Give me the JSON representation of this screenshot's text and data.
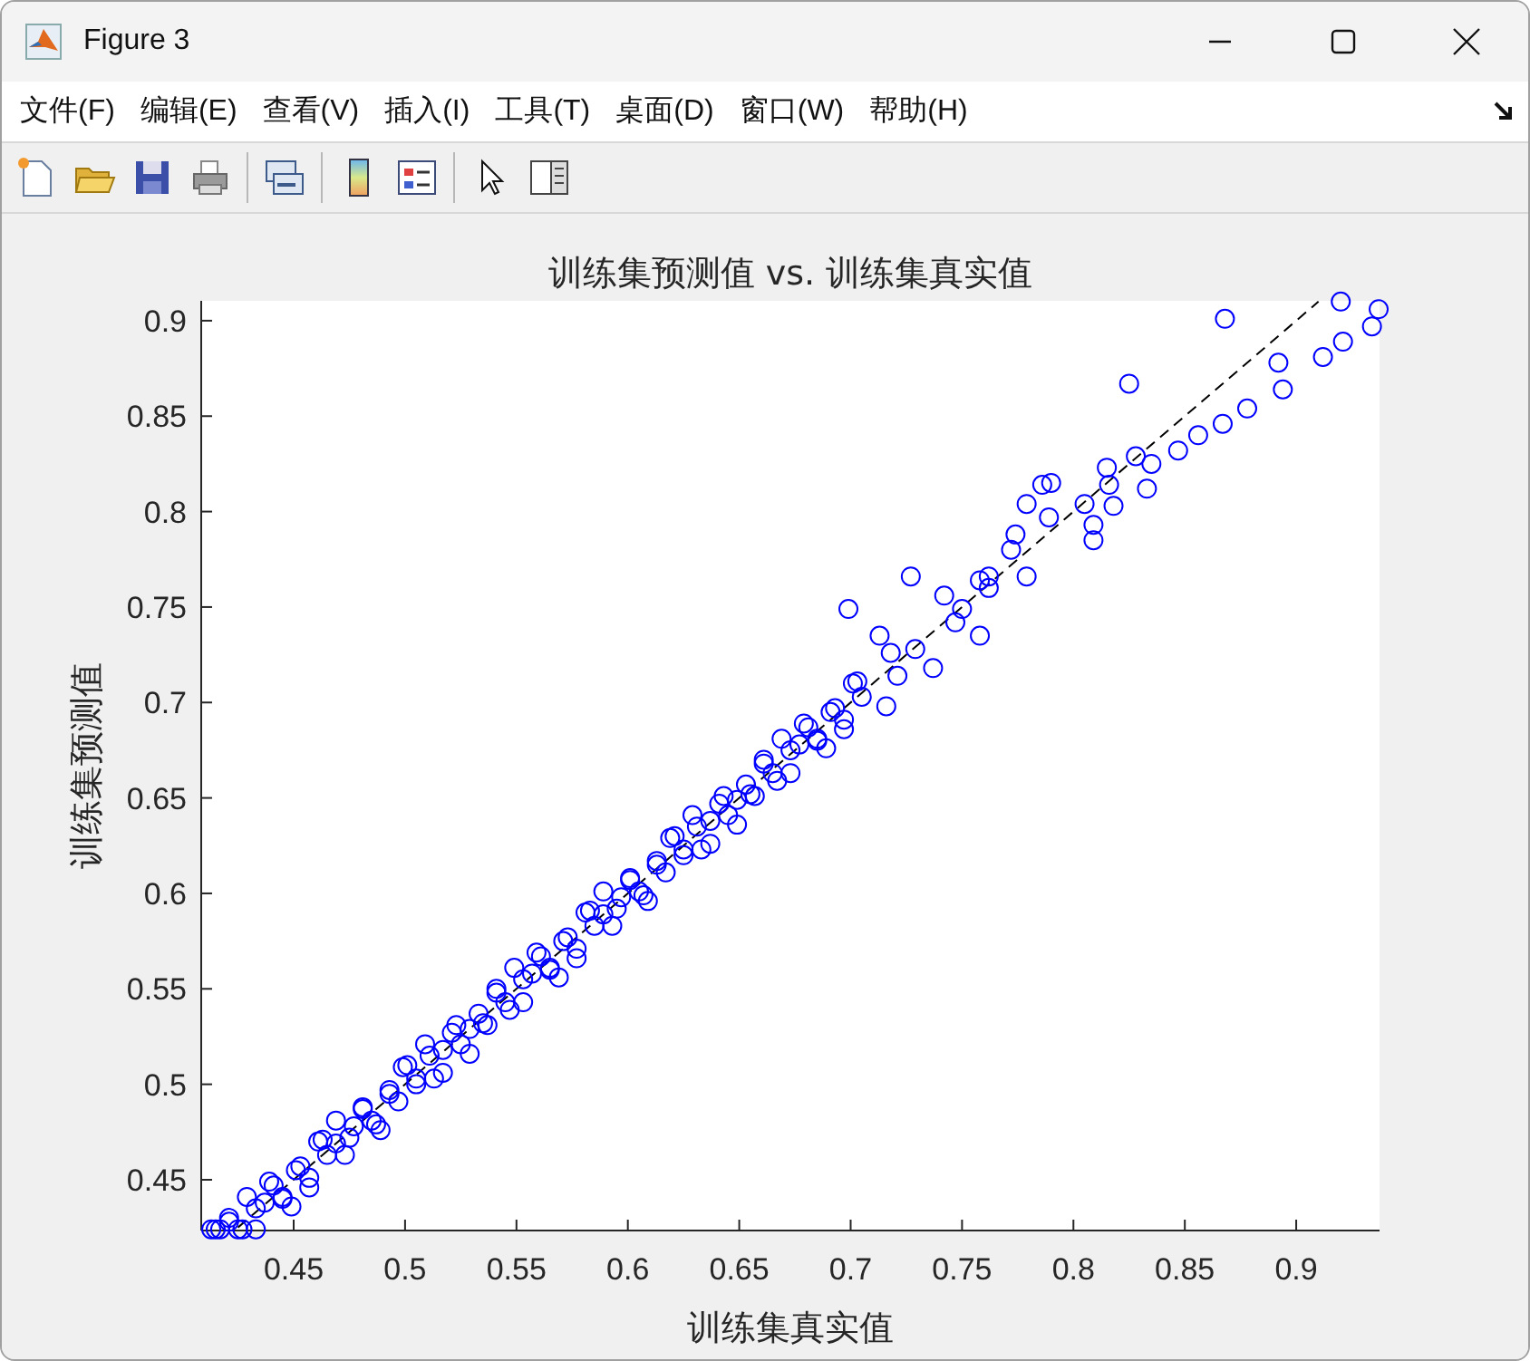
{
  "window": {
    "title": "Figure 3"
  },
  "menu": [
    "文件(F)",
    "编辑(E)",
    "查看(V)",
    "插入(I)",
    "工具(T)",
    "桌面(D)",
    "窗口(W)",
    "帮助(H)"
  ],
  "figure": {
    "chart_data": {
      "type": "scatter",
      "title": "训练集预测值 vs. 训练集真实值",
      "xlabel": "训练集真实值",
      "ylabel": "训练集预测值",
      "x": [
        0.413,
        0.417,
        0.421,
        0.425,
        0.429,
        0.433,
        0.437,
        0.441,
        0.445,
        0.449,
        0.453,
        0.457,
        0.461,
        0.465,
        0.469,
        0.473,
        0.477,
        0.481,
        0.485,
        0.489,
        0.493,
        0.497,
        0.501,
        0.505,
        0.509,
        0.513,
        0.517,
        0.521,
        0.525,
        0.529,
        0.533,
        0.537,
        0.541,
        0.545,
        0.549,
        0.553,
        0.557,
        0.561,
        0.565,
        0.569,
        0.573,
        0.577,
        0.581,
        0.585,
        0.589,
        0.593,
        0.597,
        0.601,
        0.605,
        0.609,
        0.613,
        0.617,
        0.621,
        0.625,
        0.629,
        0.633,
        0.637,
        0.641,
        0.645,
        0.649,
        0.653,
        0.657,
        0.661,
        0.665,
        0.669,
        0.673,
        0.677,
        0.681,
        0.685,
        0.689,
        0.693,
        0.697,
        0.701,
        0.705,
        0.415,
        0.421,
        0.427,
        0.433,
        0.439,
        0.445,
        0.451,
        0.457,
        0.463,
        0.469,
        0.475,
        0.481,
        0.487,
        0.493,
        0.499,
        0.505,
        0.511,
        0.517,
        0.523,
        0.529,
        0.535,
        0.541,
        0.547,
        0.553,
        0.559,
        0.565,
        0.571,
        0.577,
        0.583,
        0.589,
        0.595,
        0.601,
        0.607,
        0.613,
        0.619,
        0.625,
        0.631,
        0.637,
        0.643,
        0.649,
        0.655,
        0.661,
        0.667,
        0.673,
        0.679,
        0.685,
        0.691,
        0.697,
        0.703,
        0.92,
        0.937,
        0.934,
        0.921,
        0.912,
        0.892,
        0.868,
        0.894,
        0.878,
        0.867,
        0.856,
        0.847,
        0.825,
        0.828,
        0.835,
        0.815,
        0.816,
        0.833,
        0.805,
        0.818,
        0.809,
        0.809,
        0.786,
        0.79,
        0.779,
        0.789,
        0.774,
        0.772,
        0.779,
        0.762,
        0.762,
        0.758,
        0.75,
        0.727,
        0.742,
        0.758,
        0.747,
        0.699,
        0.737,
        0.729,
        0.716,
        0.713,
        0.718,
        0.721,
        0.425,
        0.91
      ],
      "series": [
        {
          "color": "#0000ff",
          "values": [
            0.424,
            0.424,
            0.43,
            0.424,
            0.441,
            0.424,
            0.438,
            0.447,
            0.441,
            0.436,
            0.457,
            0.451,
            0.47,
            0.463,
            0.481,
            0.463,
            0.478,
            0.487,
            0.481,
            0.476,
            0.497,
            0.491,
            0.51,
            0.503,
            0.521,
            0.503,
            0.518,
            0.527,
            0.521,
            0.516,
            0.537,
            0.531,
            0.55,
            0.543,
            0.561,
            0.543,
            0.558,
            0.567,
            0.561,
            0.556,
            0.577,
            0.571,
            0.59,
            0.583,
            0.601,
            0.583,
            0.598,
            0.607,
            0.601,
            0.596,
            0.617,
            0.611,
            0.63,
            0.623,
            0.641,
            0.623,
            0.638,
            0.647,
            0.641,
            0.636,
            0.657,
            0.651,
            0.67,
            0.663,
            0.681,
            0.663,
            0.678,
            0.687,
            0.681,
            0.676,
            0.697,
            0.691,
            0.71,
            0.703,
            0.424,
            0.428,
            0.424,
            0.435,
            0.449,
            0.44,
            0.455,
            0.446,
            0.471,
            0.469,
            0.472,
            0.488,
            0.479,
            0.495,
            0.509,
            0.5,
            0.515,
            0.506,
            0.531,
            0.529,
            0.532,
            0.548,
            0.539,
            0.555,
            0.569,
            0.56,
            0.575,
            0.566,
            0.591,
            0.589,
            0.592,
            0.608,
            0.599,
            0.615,
            0.629,
            0.62,
            0.635,
            0.626,
            0.651,
            0.649,
            0.652,
            0.668,
            0.659,
            0.675,
            0.689,
            0.68,
            0.695,
            0.686,
            0.711,
            0.91,
            0.906,
            0.897,
            0.889,
            0.881,
            0.878,
            0.901,
            0.864,
            0.854,
            0.846,
            0.84,
            0.832,
            0.867,
            0.829,
            0.825,
            0.823,
            0.814,
            0.812,
            0.804,
            0.803,
            0.785,
            0.793,
            0.814,
            0.815,
            0.804,
            0.797,
            0.788,
            0.78,
            0.766,
            0.766,
            0.76,
            0.764,
            0.749,
            0.766,
            0.756,
            0.735,
            0.742,
            0.749,
            0.718,
            0.728,
            0.698,
            0.735,
            0.726,
            0.714,
            null,
            null
          ]
        },
        {
          "type": "line",
          "line_style": "dashed",
          "color": "#000000",
          "values": [
            null,
            null,
            null,
            null,
            null,
            null,
            null,
            null,
            null,
            null,
            null,
            null,
            null,
            null,
            null,
            null,
            null,
            null,
            null,
            null,
            null,
            null,
            null,
            null,
            null,
            null,
            null,
            null,
            null,
            null,
            null,
            null,
            null,
            null,
            null,
            null,
            null,
            null,
            null,
            null,
            null,
            null,
            null,
            null,
            null,
            null,
            null,
            null,
            null,
            null,
            null,
            null,
            null,
            null,
            null,
            null,
            null,
            null,
            null,
            null,
            null,
            null,
            null,
            null,
            null,
            null,
            null,
            null,
            null,
            null,
            null,
            null,
            null,
            null,
            null,
            null,
            null,
            null,
            null,
            null,
            null,
            null,
            null,
            null,
            null,
            null,
            null,
            null,
            null,
            null,
            null,
            null,
            null,
            null,
            null,
            null,
            null,
            null,
            null,
            null,
            null,
            null,
            null,
            null,
            null,
            null,
            null,
            null,
            null,
            null,
            null,
            null,
            null,
            null,
            null,
            null,
            null,
            null,
            null,
            null,
            null,
            null,
            null,
            null,
            null,
            null,
            null,
            null,
            null,
            null,
            null,
            null,
            null,
            null,
            null,
            null,
            null,
            null,
            null,
            null,
            null,
            null,
            null,
            null,
            null,
            null,
            null,
            null,
            null,
            null,
            null,
            null,
            null,
            null,
            null,
            null,
            null,
            null,
            null,
            null,
            null,
            null,
            null,
            null,
            null,
            null,
            null,
            0.425,
            0.91
          ]
        }
      ],
      "xlim": [
        0.4085,
        0.9374
      ],
      "ylim": [
        0.4234,
        0.9104
      ],
      "xticks": [
        0.45,
        0.5,
        0.55,
        0.6,
        0.65,
        0.7,
        0.75,
        0.8,
        0.85,
        0.9
      ],
      "yticks": [
        0.45,
        0.5,
        0.55,
        0.6,
        0.65,
        0.7,
        0.75,
        0.8,
        0.85,
        0.9
      ]
    }
  }
}
